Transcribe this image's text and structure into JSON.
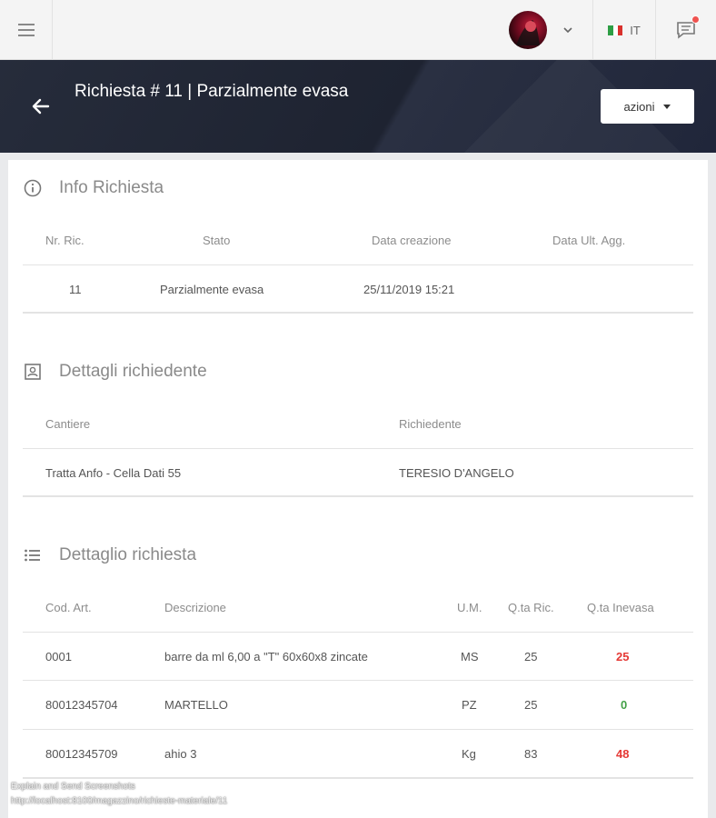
{
  "topbar": {
    "language": "IT",
    "flag_colors": [
      "#2e9e45",
      "#ffffff",
      "#d9312c"
    ]
  },
  "header": {
    "title": "Richiesta # 11 | Parzialmente evasa",
    "actions_label": "azioni"
  },
  "info_section": {
    "title": "Info Richiesta",
    "headers": [
      "Nr. Ric.",
      "Stato",
      "Data creazione",
      "Data Ult. Agg."
    ],
    "row": [
      "11",
      "Parzialmente evasa",
      "25/11/2019 15:21",
      ""
    ]
  },
  "requester_section": {
    "title": "Dettagli richiedente",
    "headers": [
      "Cantiere",
      "Richiedente"
    ],
    "row": [
      "Tratta Anfo - Cella Dati 55",
      "TERESIO D'ANGELO"
    ]
  },
  "detail_section": {
    "title": "Dettaglio richiesta",
    "headers": [
      "Cod. Art.",
      "Descrizione",
      "U.M.",
      "Q.ta Ric.",
      "Q.ta Inevasa"
    ],
    "rows": [
      {
        "code": "0001",
        "description": "barre da ml 6,00 a \"T\" 60x60x8 zincate",
        "um": "MS",
        "qty": "25",
        "pending": "25",
        "pending_status": "red"
      },
      {
        "code": "80012345704",
        "description": "MARTELLO",
        "um": "PZ",
        "qty": "25",
        "pending": "0",
        "pending_status": "green"
      },
      {
        "code": "80012345709",
        "description": "ahio 3",
        "um": "Kg",
        "qty": "83",
        "pending": "48",
        "pending_status": "red"
      }
    ]
  },
  "footer": {
    "line1": "Explain and Send Screenshots",
    "line2": "http://localhost:8100/magazzino/richieste-materiale/11"
  },
  "colors": {
    "header_bg": "#1e2331",
    "status_red": "#e53935",
    "status_green": "#43a047",
    "notification_dot": "#ef5350"
  }
}
